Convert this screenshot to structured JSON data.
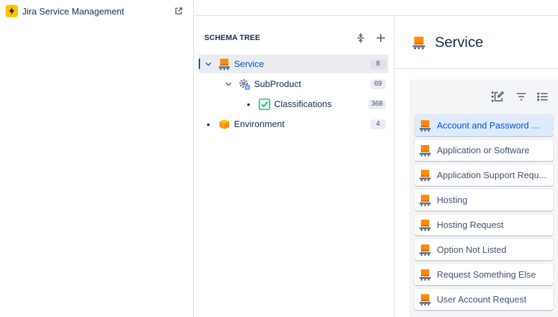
{
  "project": {
    "name": "Jira Service Management",
    "logo_color": "#ffc400",
    "logo_icon": "lightning-bolt-icon",
    "external_link_icon": "external-link-icon"
  },
  "schema_tree": {
    "title": "SCHEMA TREE",
    "collapse_all_icon": "collapse-all-icon",
    "add_icon": "plus-icon",
    "nodes": [
      {
        "label": "Service",
        "count": "8",
        "icon": "service-object-icon",
        "expander": "chevron-down-icon",
        "selected": true
      },
      {
        "label": "SubProduct",
        "count": "69",
        "icon": "gear-cube-icon",
        "expander": "chevron-down-icon",
        "selected": false
      },
      {
        "label": "Classifications",
        "count": "368",
        "icon": "checkbox-icon",
        "expander": "bullet",
        "selected": false
      },
      {
        "label": "Environment",
        "count": "4",
        "icon": "box-icon",
        "expander": "bullet",
        "selected": false
      }
    ]
  },
  "object_type": {
    "title": "Service",
    "icon": "service-object-icon",
    "toolbar": {
      "edit_list_icon": "edit-list-icon",
      "filter_icon": "filter-icon",
      "list_view_icon": "list-view-icon"
    },
    "objects": [
      {
        "label": "Account and Password Ma...",
        "selected": true
      },
      {
        "label": "Application or Software",
        "selected": false
      },
      {
        "label": "Application Support Requ...",
        "selected": false
      },
      {
        "label": "Hosting",
        "selected": false
      },
      {
        "label": "Hosting Request",
        "selected": false
      },
      {
        "label": "Option Not Listed",
        "selected": false
      },
      {
        "label": "Request Something Else",
        "selected": false
      },
      {
        "label": "User Account Request",
        "selected": false
      }
    ]
  },
  "colors": {
    "accent": "#0052cc",
    "selected_bg": "#deebff",
    "service_icon": "#ff8b00"
  }
}
